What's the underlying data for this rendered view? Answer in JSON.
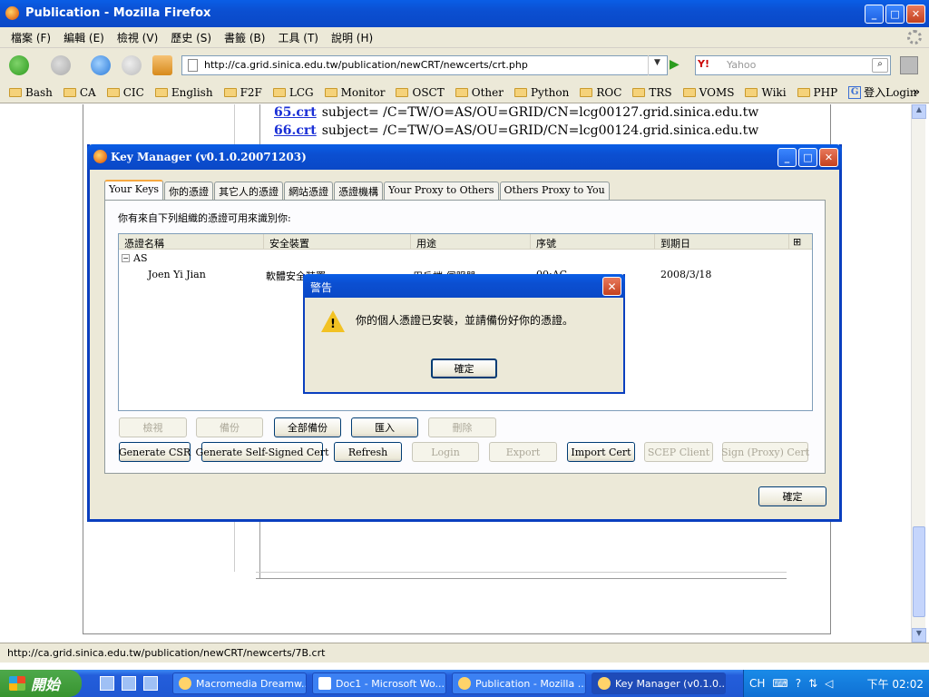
{
  "window": {
    "title": "Publication - Mozilla Firefox"
  },
  "menu": [
    "檔案 (F)",
    "編輯 (E)",
    "檢視 (V)",
    "歷史 (S)",
    "書籤 (B)",
    "工具 (T)",
    "說明 (H)"
  ],
  "nav": {
    "url": "http://ca.grid.sinica.edu.tw/publication/newCRT/newcerts/crt.php",
    "search_placeholder": "Yahoo",
    "search_engine": "Y!"
  },
  "bookmarks": [
    "Bash",
    "CA",
    "CIC",
    "English",
    "F2F",
    "LCG",
    "Monitor",
    "OSCT",
    "Other",
    "Python",
    "ROC",
    "TRS",
    "VOMS",
    "Wiki",
    "PHP"
  ],
  "bookmark_login": "登入Login",
  "bookmark_more": "»",
  "content": {
    "lines": [
      {
        "link": "65.crt",
        "text": "subject= /C=TW/O=AS/OU=GRID/CN=lcg00127.grid.sinica.edu.tw"
      },
      {
        "link": "66.crt",
        "text": "subject= /C=TW/O=AS/OU=GRID/CN=lcg00124.grid.sinica.edu.tw"
      }
    ]
  },
  "status": "http://ca.grid.sinica.edu.tw/publication/newCRT/newcerts/7B.crt",
  "keymanager": {
    "title": "Key Manager (v0.1.0.20071203)",
    "tabs": [
      "Your Keys",
      "你的憑證",
      "其它人的憑證",
      "網站憑證",
      "憑證機構",
      "Your Proxy to Others",
      "Others Proxy to You"
    ],
    "description": "你有來自下列組織的憑證可用來識別你:",
    "columns": [
      "憑證名稱",
      "安全裝置",
      "用途",
      "序號",
      "到期日"
    ],
    "group": "AS",
    "row": {
      "name": "Joen Yi Jian",
      "device": "軟體安全裝置",
      "usage": "用戶端,伺服器",
      "serial": "00:AC",
      "expiry": "2008/3/18"
    },
    "buttons_row1": [
      "檢視",
      "備份",
      "全部備份",
      "匯入",
      "刪除"
    ],
    "buttons_row2": [
      "Generate CSR",
      "Generate Self-Signed Cert",
      "Refresh",
      "Login",
      "Export",
      "Import Cert",
      "SCEP Client",
      "Sign (Proxy) Cert"
    ],
    "ok": "確定"
  },
  "alert": {
    "title": "警告",
    "message": "你的個人憑證已安裝，並請備份好你的憑證。",
    "ok": "確定"
  },
  "taskbar": {
    "start": "開始",
    "tasks": [
      "Macromedia Dreamw...",
      "Doc1 - Microsoft Wo...",
      "Publication - Mozilla ...",
      "Key Manager (v0.1.0..."
    ],
    "lang": "CH",
    "clock": "下午 02:02"
  }
}
